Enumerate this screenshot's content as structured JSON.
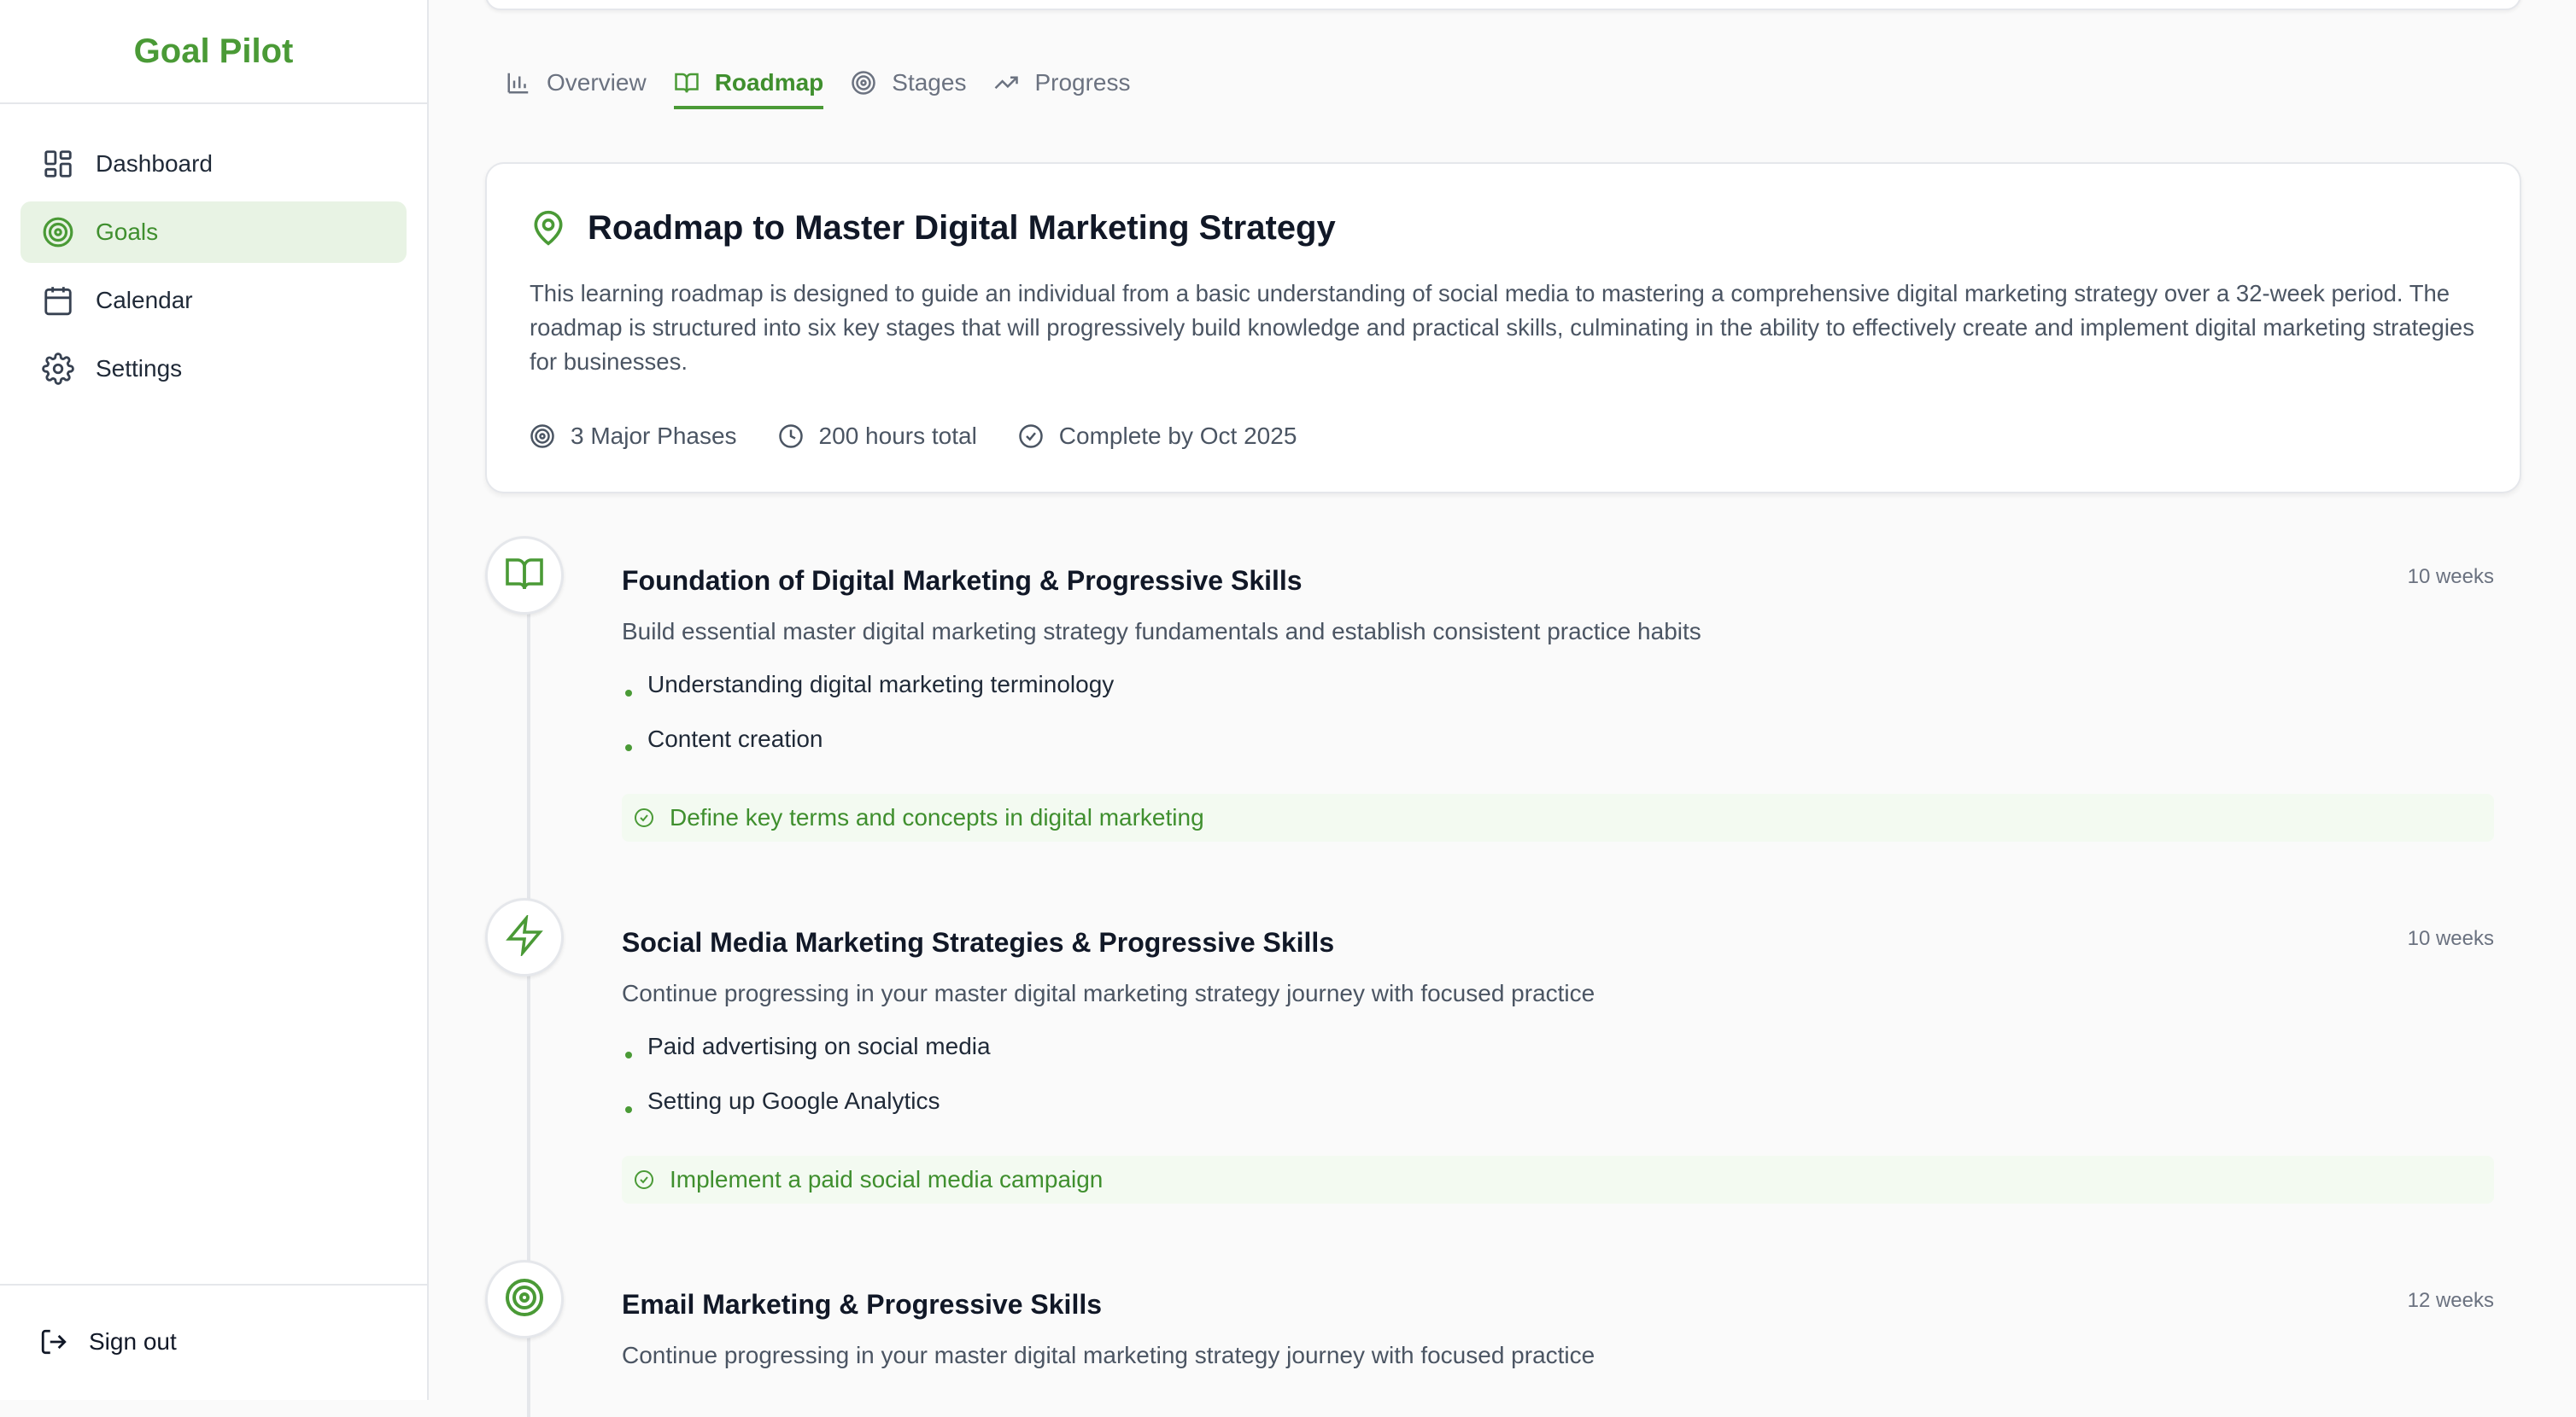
{
  "app": {
    "brand": "Goal Pilot"
  },
  "sidebar": {
    "items": [
      {
        "label": "Dashboard",
        "icon": "dashboard-icon",
        "active": false
      },
      {
        "label": "Goals",
        "icon": "target-icon",
        "active": true
      },
      {
        "label": "Calendar",
        "icon": "calendar-icon",
        "active": false
      },
      {
        "label": "Settings",
        "icon": "gear-icon",
        "active": false
      }
    ],
    "sign_out": "Sign out"
  },
  "tabs": [
    {
      "label": "Overview",
      "icon": "bar-chart-icon"
    },
    {
      "label": "Roadmap",
      "icon": "book-icon",
      "active": true
    },
    {
      "label": "Stages",
      "icon": "target-icon"
    },
    {
      "label": "Progress",
      "icon": "trending-up-icon"
    }
  ],
  "roadmap": {
    "title": "Roadmap to Master Digital Marketing Strategy",
    "description": "This learning roadmap is designed to guide an individual from a basic understanding of social media to mastering a comprehensive digital marketing strategy over a 32-week period. The roadmap is structured into six key stages that will progressively build knowledge and practical skills, culminating in the ability to effectively create and implement digital marketing strategies for businesses.",
    "meta": {
      "phases": "3 Major Phases",
      "hours": "200 hours total",
      "complete_by": "Complete by Oct 2025"
    }
  },
  "phases": [
    {
      "title": "Foundation of Digital Marketing & Progressive Skills",
      "duration": "10 weeks",
      "description": "Build essential master digital marketing strategy fundamentals and establish consistent practice habits",
      "skills": [
        "Understanding digital marketing terminology",
        "Content creation"
      ],
      "milestone": "Define key terms and concepts in digital marketing",
      "icon": "book-icon"
    },
    {
      "title": "Social Media Marketing Strategies & Progressive Skills",
      "duration": "10 weeks",
      "description": "Continue progressing in your master digital marketing strategy journey with focused practice",
      "skills": [
        "Paid advertising on social media",
        "Setting up Google Analytics"
      ],
      "milestone": "Implement a paid social media campaign",
      "icon": "lightning-icon"
    },
    {
      "title": "Email Marketing & Progressive Skills",
      "duration": "12 weeks",
      "description": "Continue progressing in your master digital marketing strategy journey with focused practice",
      "icon": "target-icon"
    }
  ],
  "colors": {
    "accent": "#4a9a36",
    "accent_bg": "#e8f3e4",
    "milestone_bg": "#f3faf1"
  }
}
